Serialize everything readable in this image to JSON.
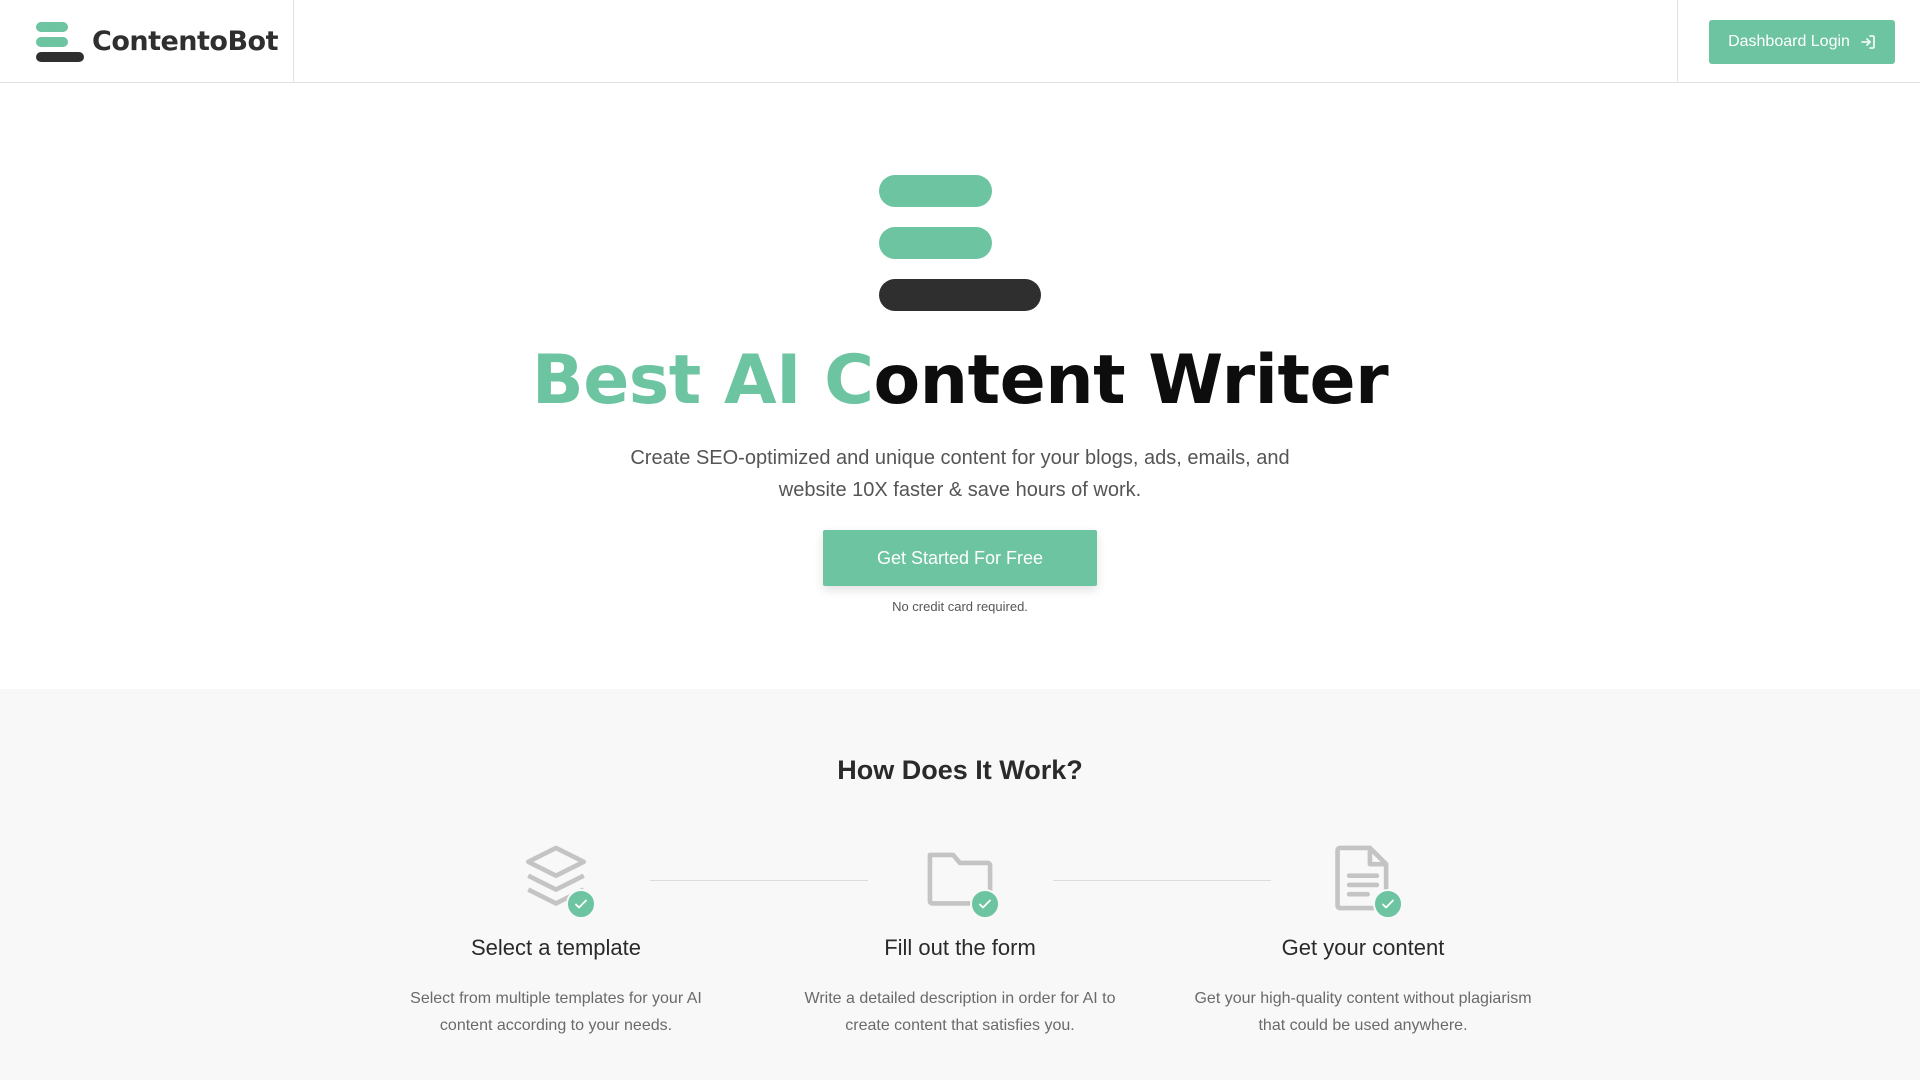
{
  "colors": {
    "green": "#6cc4a1",
    "dark": "#2f2f2f"
  },
  "nav": {
    "brand_name": "ContentoBot",
    "login_label": "Dashboard Login",
    "login_icon": "sign-in-icon"
  },
  "hero": {
    "headline_accent": "Best AI C",
    "headline_rest": "ontent Writer",
    "subtitle_line1": "Create SEO-optimized and unique content for your blogs, ads, emails, and",
    "subtitle_line2": "website 10X faster & save hours of work.",
    "cta_label": "Get Started For Free",
    "note": "No credit card required."
  },
  "how": {
    "title": "How Does It Work?",
    "steps": [
      {
        "icon": "layers-icon",
        "title": "Select a template",
        "desc_line1": "Select from multiple templates for your AI",
        "desc_line2": "content according to your needs."
      },
      {
        "icon": "folder-icon",
        "title": "Fill out the form",
        "desc_line1": "Write a detailed description in order for AI to",
        "desc_line2": "create content that satisfies you."
      },
      {
        "icon": "document-icon",
        "title": "Get your content",
        "desc_line1": "Get your high-quality content without plagiarism",
        "desc_line2": "that could be used anywhere."
      }
    ]
  }
}
